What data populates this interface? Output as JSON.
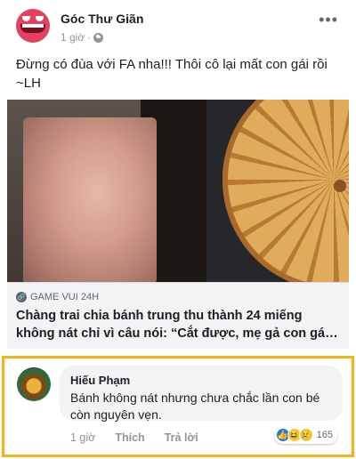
{
  "post": {
    "page_name": "Góc Thư Giãn",
    "time": "1 giờ",
    "separator": "·",
    "text": "Đừng có đùa với FA nha!!! Thôi cô lại mất con gái rồi ~LH"
  },
  "link": {
    "source": "GAME VUI 24H",
    "headline": "Chàng trai chia bánh trung thu thành 24 miếng\nkhông nát chỉ vì câu nói: “Cắt được, mẹ gả con gá…"
  },
  "comment": {
    "author": "Hiếu Phạm",
    "text": "Bánh không nát nhưng chưa chắc lần con bé còn nguyên vẹn.",
    "time": "1 giờ",
    "like_label": "Thích",
    "reply_label": "Trả lời",
    "reaction_count": "165",
    "reaction_icons": [
      "like-icon",
      "haha-icon",
      "sad-icon"
    ]
  },
  "colors": {
    "highlight_border": "#f7b216",
    "brand_blue": "#1877f2",
    "meta_gray": "#90949c"
  }
}
